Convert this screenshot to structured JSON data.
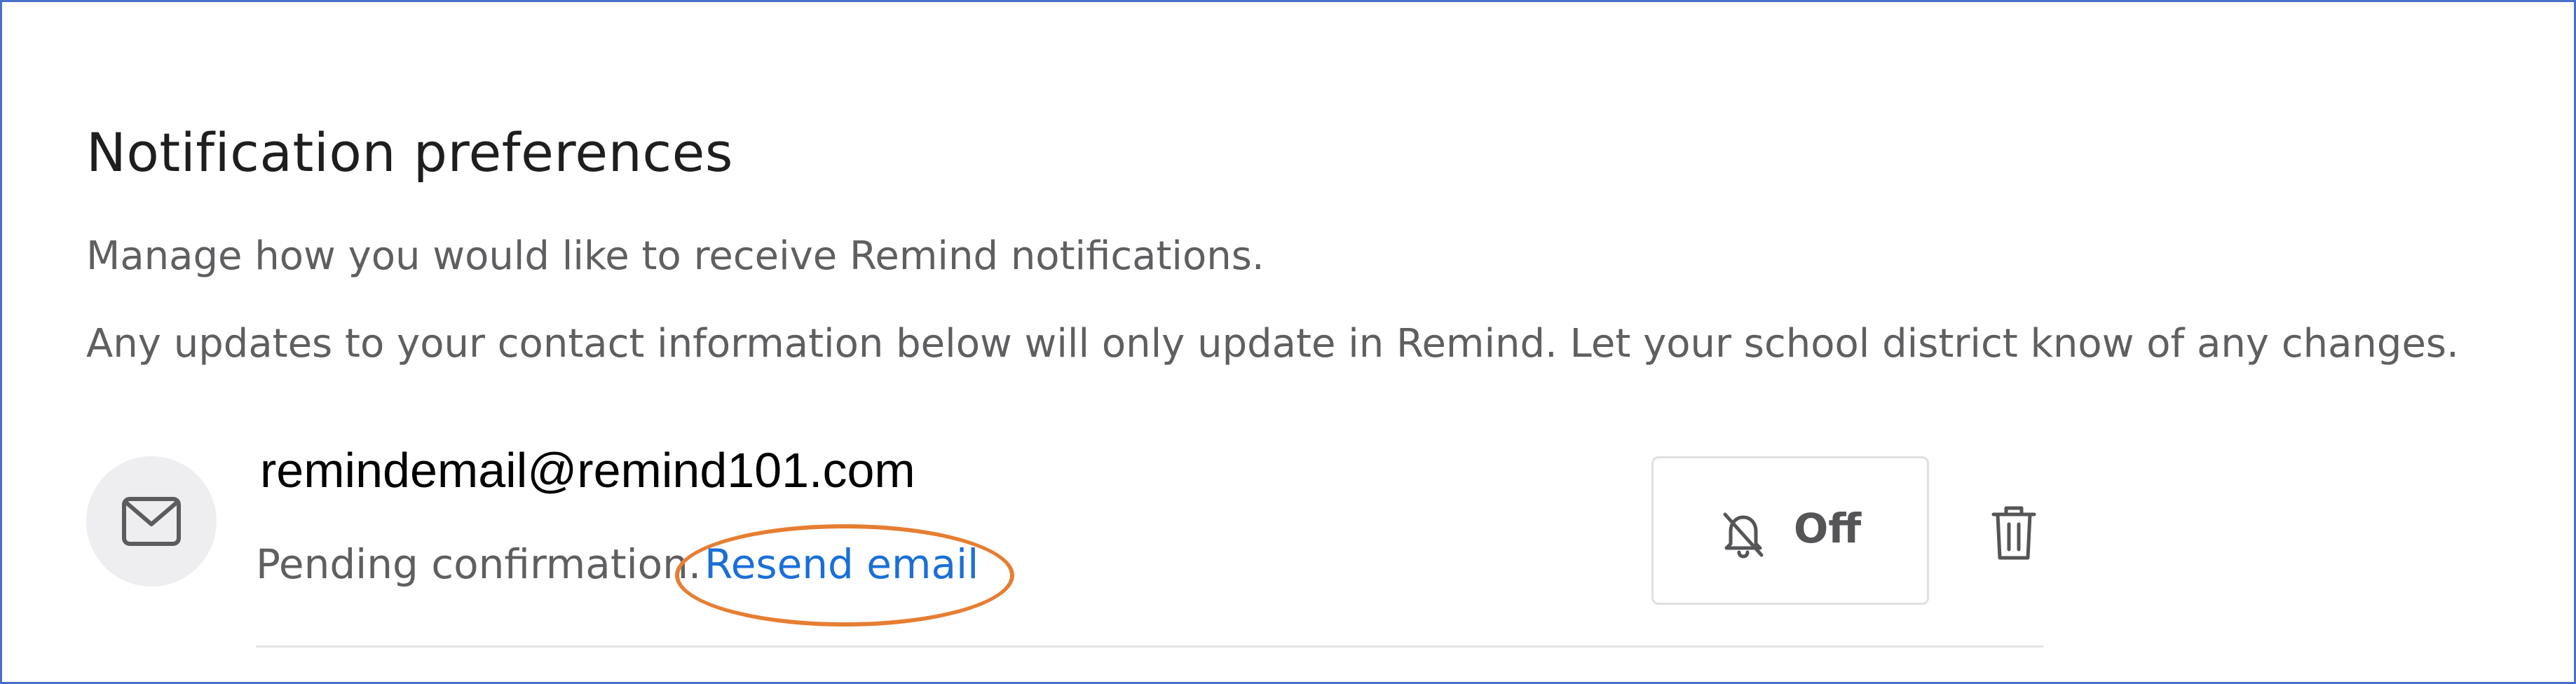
{
  "header": {
    "title": "Notification preferences",
    "description_1": "Manage how you would like to receive Remind notifications.",
    "description_2": "Any updates to your contact information below will only update in Remind. Let your school district know of any changes."
  },
  "contact": {
    "icon": "mail-icon",
    "email": "remindemail@remind101.com",
    "status": "Pending confirmation.",
    "resend_link": "Resend email"
  },
  "notification_toggle": {
    "icon": "bell-off-icon",
    "label": "Off"
  },
  "delete": {
    "icon": "trash-icon"
  },
  "colors": {
    "link": "#1a6fd8",
    "highlight": "#e67e32",
    "frame_border": "#4a6fc8",
    "text_primary": "#1e1e1e",
    "text_secondary": "#5f5f62"
  }
}
